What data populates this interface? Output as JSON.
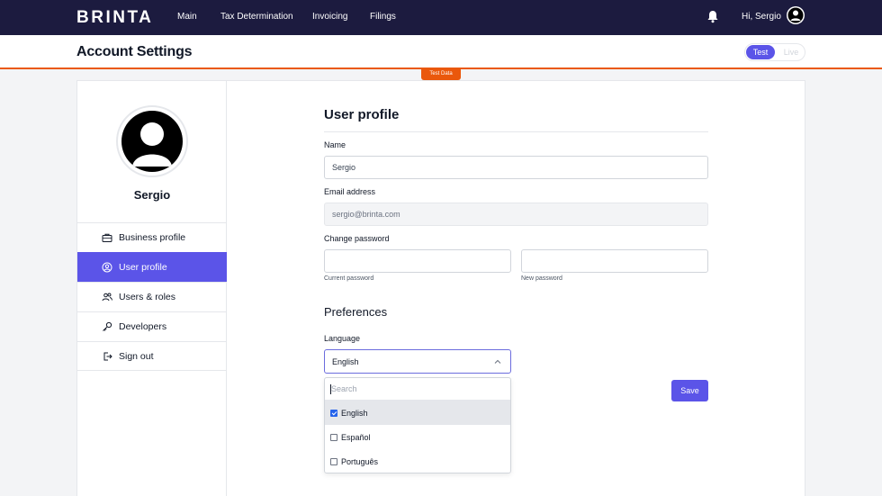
{
  "nav": {
    "logo": "BRINTA",
    "links": [
      "Main",
      "Tax Determination",
      "Invoicing",
      "Filings"
    ],
    "greeting": "Hi, Sergio",
    "bell_icon": "bell-icon",
    "avatar_icon": "user-avatar-icon"
  },
  "header": {
    "title": "Account Settings",
    "toggle": {
      "test": "Test",
      "live": "Live"
    },
    "badge": "Test Data"
  },
  "sidebar": {
    "name": "Sergio",
    "items": [
      {
        "label": "Business profile",
        "icon": "briefcase-icon"
      },
      {
        "label": "User profile",
        "icon": "user-circle-icon",
        "active": true
      },
      {
        "label": "Users & roles",
        "icon": "users-icon"
      },
      {
        "label": "Developers",
        "icon": "key-icon"
      },
      {
        "label": "Sign out",
        "icon": "sign-out-icon"
      }
    ]
  },
  "form": {
    "title": "User profile",
    "name_label": "Name",
    "name_value": "Sergio",
    "email_label": "Email address",
    "email_value": "sergio@brinta.com",
    "password_label": "Change password",
    "current_password_label": "Current password",
    "new_password_label": "New password",
    "preferences_title": "Preferences",
    "language_label": "Language",
    "language_value": "English",
    "save_label": "Save"
  },
  "dropdown": {
    "search_placeholder": "Search",
    "options": [
      {
        "label": "English",
        "checked": true
      },
      {
        "label": "Español",
        "checked": false
      },
      {
        "label": "Português",
        "checked": false
      }
    ]
  },
  "colors": {
    "nav_bg": "#1c1b3f",
    "accent": "#5b54e8",
    "test_badge": "#ea580c"
  }
}
